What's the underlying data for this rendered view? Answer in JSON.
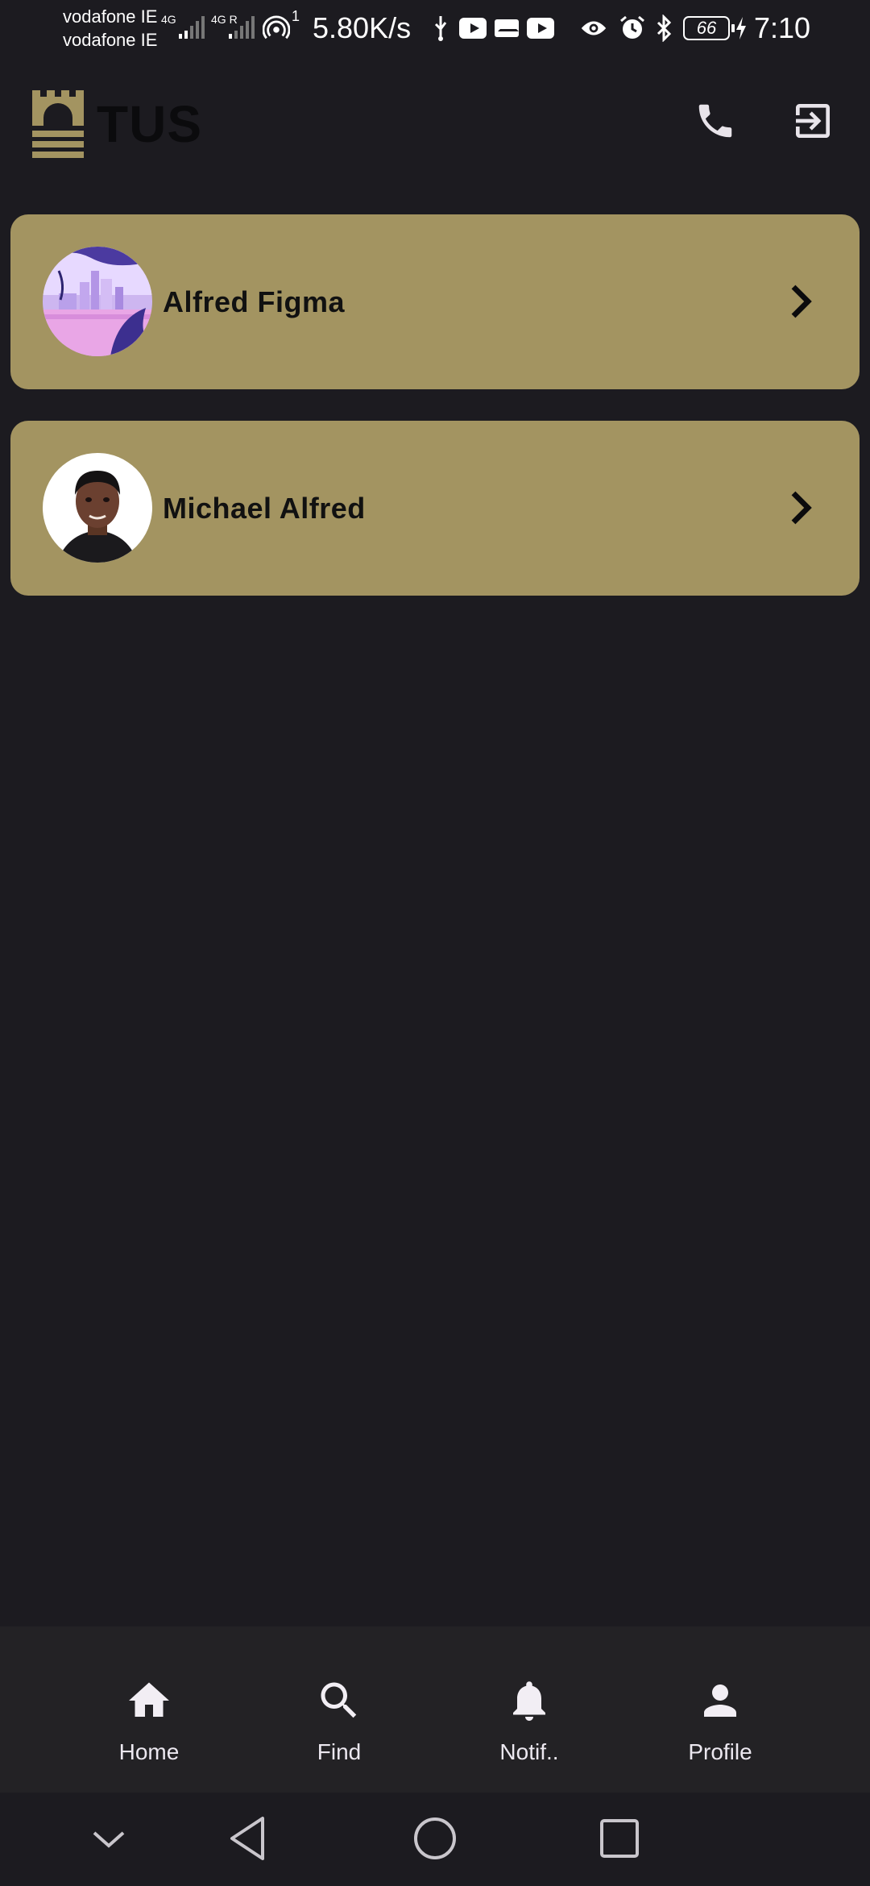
{
  "status_bar": {
    "carrier_1": "vodafone IE",
    "carrier_2": "vodafone IE",
    "net_1": "4G",
    "net_2": "4G R",
    "hotspot_count": "1",
    "speed": "5.80K/s",
    "battery": "66",
    "time": "7:10"
  },
  "header": {
    "logo_text": "TUS",
    "brand_color": "#a39461"
  },
  "contacts": [
    {
      "name": "Alfred Figma",
      "avatar": "city-illustration"
    },
    {
      "name": "Michael Alfred",
      "avatar": "portrait-photo"
    }
  ],
  "bottom_nav": {
    "items": [
      {
        "label": "Home",
        "icon": "home-icon"
      },
      {
        "label": "Find",
        "icon": "search-icon"
      },
      {
        "label": "Notif..",
        "icon": "bell-icon"
      },
      {
        "label": "Profile",
        "icon": "person-icon"
      }
    ]
  }
}
